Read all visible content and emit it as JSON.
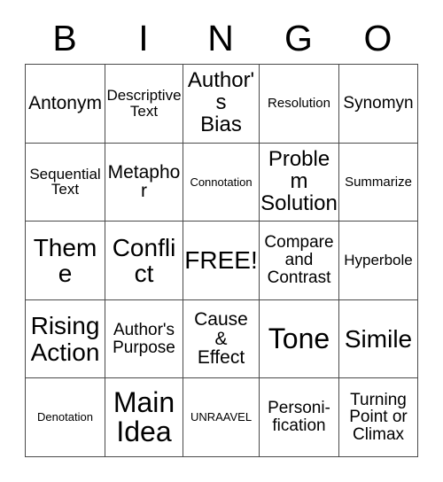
{
  "card": {
    "title": "BINGO",
    "header_letters": [
      "B",
      "I",
      "N",
      "G",
      "O"
    ],
    "free_space_label": "FREE!",
    "rows": [
      [
        {
          "label": "Antonym",
          "size": "fs-l"
        },
        {
          "label": "Descriptive\nText",
          "size": "fs-m"
        },
        {
          "label": "Author's\nBias",
          "size": "fs-xl"
        },
        {
          "label": "Resolution",
          "size": "fs-s"
        },
        {
          "label": "Synomyn",
          "size": "fs-ml"
        }
      ],
      [
        {
          "label": "Sequential\nText",
          "size": "fs-m"
        },
        {
          "label": "Metaphor",
          "size": "fs-l"
        },
        {
          "label": "Connotation",
          "size": "fs-xs"
        },
        {
          "label": "Problem\nSolution",
          "size": "fs-xl"
        },
        {
          "label": "Summarize",
          "size": "fs-s"
        }
      ],
      [
        {
          "label": "Theme",
          "size": "fs-xxl"
        },
        {
          "label": "Conflict",
          "size": "fs-xxl"
        },
        {
          "label": "FREE!",
          "size": "fs-xxl"
        },
        {
          "label": "Compare\nand\nContrast",
          "size": "fs-ml"
        },
        {
          "label": "Hyperbole",
          "size": "fs-m"
        }
      ],
      [
        {
          "label": "Rising\nAction",
          "size": "fs-xxl"
        },
        {
          "label": "Author's\nPurpose",
          "size": "fs-ml"
        },
        {
          "label": "Cause\n&\nEffect",
          "size": "fs-l"
        },
        {
          "label": "Tone",
          "size": "fs-huge"
        },
        {
          "label": "Simile",
          "size": "fs-xxl"
        }
      ],
      [
        {
          "label": "Denotation",
          "size": "fs-xs"
        },
        {
          "label": "Main\nIdea",
          "size": "fs-huge"
        },
        {
          "label": "UNRAAVEL",
          "size": "fs-xs"
        },
        {
          "label": "Personi-\nfication",
          "size": "fs-ml"
        },
        {
          "label": "Turning\nPoint or\nClimax",
          "size": "fs-ml"
        }
      ]
    ]
  },
  "colors": {
    "background": "#ffffff",
    "text": "#000000",
    "border": "#4a4a4a"
  }
}
